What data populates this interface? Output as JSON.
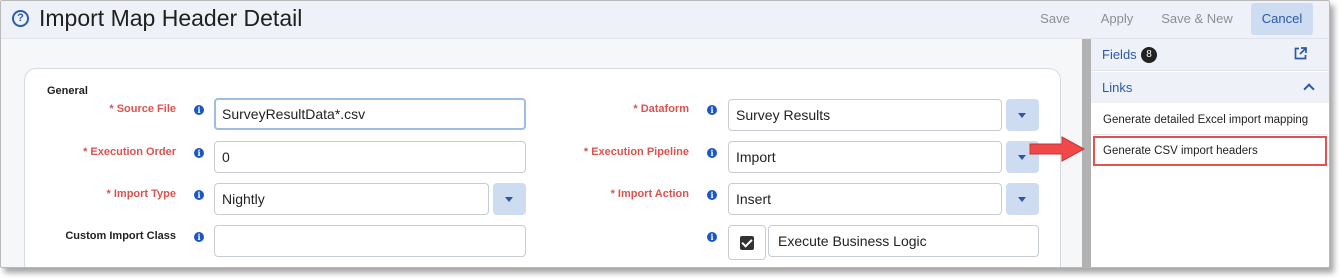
{
  "header": {
    "title": "Import Map Header Detail",
    "buttons": {
      "save": "Save",
      "apply": "Apply",
      "save_new": "Save & New",
      "cancel": "Cancel"
    }
  },
  "form": {
    "section_title": "General",
    "fields": {
      "source_file": {
        "label": "* Source File",
        "value": "SurveyResultData*.csv"
      },
      "execution_order": {
        "label": "* Execution Order",
        "value": "0"
      },
      "import_type": {
        "label": "* Import Type",
        "value": "Nightly"
      },
      "custom_import_class": {
        "label": "Custom Import Class",
        "value": ""
      },
      "dataform": {
        "label": "* Dataform",
        "value": "Survey Results"
      },
      "execution_pipeline": {
        "label": "* Execution Pipeline",
        "value": "Import"
      },
      "import_action": {
        "label": "* Import Action",
        "value": "Insert"
      },
      "execute_business_logic": {
        "label": "Execute Business Logic",
        "checked": true
      }
    },
    "info_glyph": "i"
  },
  "side_panel": {
    "fields_label": "Fields",
    "fields_count": "8",
    "links_label": "Links",
    "links": [
      "Generate detailed Excel import mapping",
      "Generate CSV import headers"
    ]
  },
  "icons": {
    "help": "help-circle-icon",
    "info": "info-icon",
    "external": "external-link-icon",
    "collapse": "chevron-up-icon",
    "dropdown": "caret-down-icon",
    "callout": "arrow-right-icon"
  },
  "colors": {
    "header_bg": "#eef2f8",
    "accent": "#2a58a8",
    "required": "#d9534f",
    "highlight": "#e05353"
  }
}
